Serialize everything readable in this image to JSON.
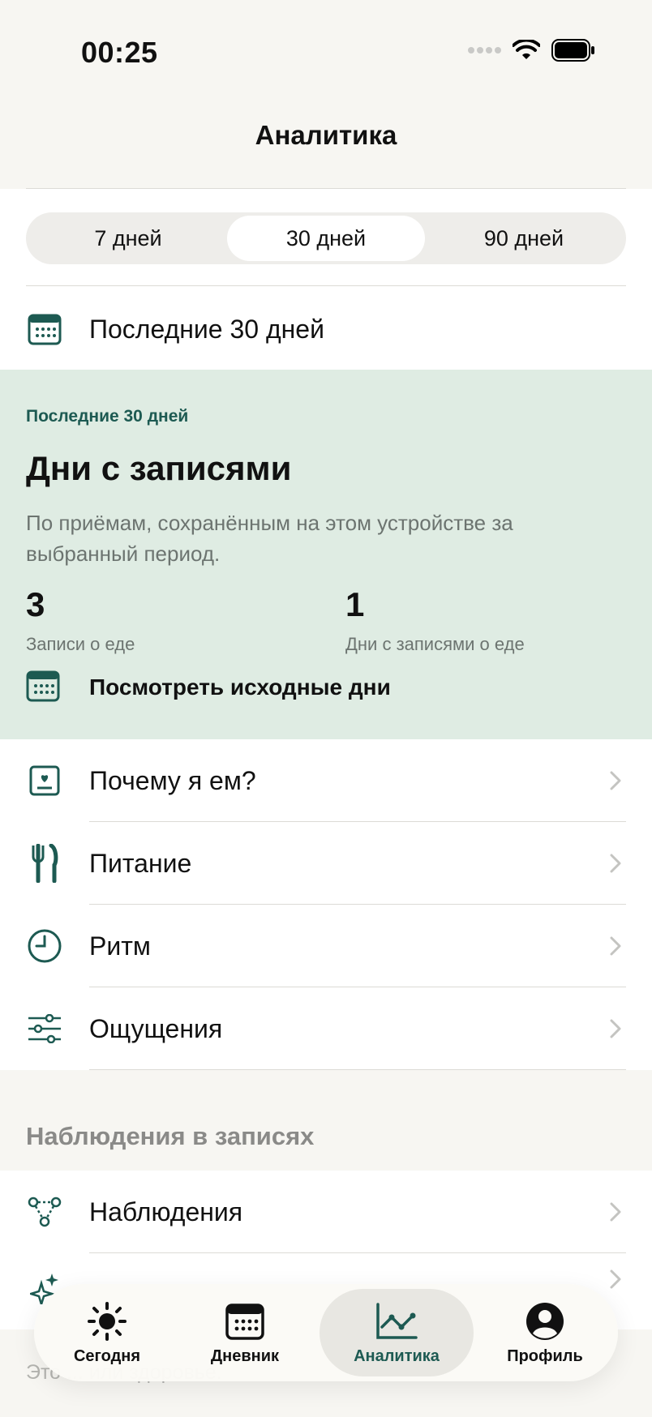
{
  "status_bar": {
    "time": "00:25"
  },
  "nav": {
    "title": "Аналитика"
  },
  "period_selector": {
    "options": [
      "7 дней",
      "30 дней",
      "90 дней"
    ],
    "selected": "30 дней"
  },
  "date_range": {
    "label": "Последние 30 дней"
  },
  "summary_card": {
    "eyebrow": "Последние 30 дней",
    "title": "Дни с записями",
    "description": "По приёмам, сохранённым на этом устройстве за выбранный период.",
    "stats": [
      {
        "value": "3",
        "label": "Записи о еде"
      },
      {
        "value": "1",
        "label": "Дни с записями о еде"
      }
    ],
    "link_label": "Посмотреть исходные дни"
  },
  "menu_items": [
    {
      "label": "Почему я ем?",
      "icon": "journal-heart-icon"
    },
    {
      "label": "Питание",
      "icon": "fork-knife-icon"
    },
    {
      "label": "Ритм",
      "icon": "clock-icon"
    },
    {
      "label": "Ощущения",
      "icon": "sliders-icon"
    }
  ],
  "observations_section": {
    "header": "Наблюдения в записях",
    "items": [
      {
        "label": "Наблюдения",
        "icon": "nodes-icon"
      },
      {
        "label": "",
        "icon": "sparkles-icon"
      }
    ]
  },
  "footer": {
    "text": "Это ... или здоровье."
  },
  "tabbar": {
    "tabs": [
      {
        "label": "Сегодня",
        "icon": "sun-icon"
      },
      {
        "label": "Дневник",
        "icon": "calendar-icon"
      },
      {
        "label": "Аналитика",
        "icon": "chart-icon"
      },
      {
        "label": "Профиль",
        "icon": "profile-icon"
      }
    ],
    "active": "Аналитика"
  },
  "colors": {
    "accent": "#1d5a52",
    "card_bg": "#dfece3",
    "page_bg": "#f7f6f2"
  }
}
